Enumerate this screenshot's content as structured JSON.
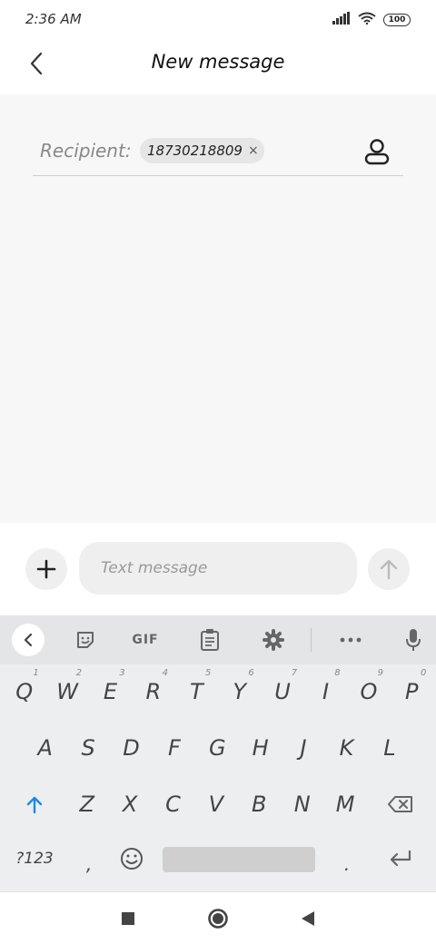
{
  "status_bar": {
    "time": "2:36 AM",
    "battery": "100",
    "icons": [
      "signal-icon",
      "wifi-icon",
      "battery-icon"
    ]
  },
  "header": {
    "title": "New message",
    "back_icon": "chevron-left-icon"
  },
  "recipient": {
    "label": "Recipient:",
    "chip_value": "18730218809",
    "chip_remove": "×",
    "contact_icon": "contact-icon"
  },
  "compose": {
    "placeholder": "Text message",
    "attach_icon": "plus-icon",
    "send_icon": "arrow-up-icon"
  },
  "keyboard": {
    "toolbar": {
      "gif_label": "GIF",
      "icons": [
        "chevron-left-icon",
        "sticker-icon",
        "clipboard-icon",
        "gear-icon",
        "more-icon",
        "mic-icon"
      ]
    },
    "row1": [
      "Q",
      "W",
      "E",
      "R",
      "T",
      "Y",
      "U",
      "I",
      "O",
      "P"
    ],
    "row1_hints": [
      "1",
      "2",
      "3",
      "4",
      "5",
      "6",
      "7",
      "8",
      "9",
      "0"
    ],
    "row2": [
      "A",
      "S",
      "D",
      "F",
      "G",
      "H",
      "J",
      "K",
      "L"
    ],
    "row3": [
      "Z",
      "X",
      "C",
      "V",
      "B",
      "N",
      "M"
    ],
    "symbols_label": "?123",
    "comma": ",",
    "period": ".",
    "accent_color": "#1e88e5"
  },
  "nav_bar": {
    "icons": [
      "recents-icon",
      "home-icon",
      "back-icon"
    ]
  }
}
